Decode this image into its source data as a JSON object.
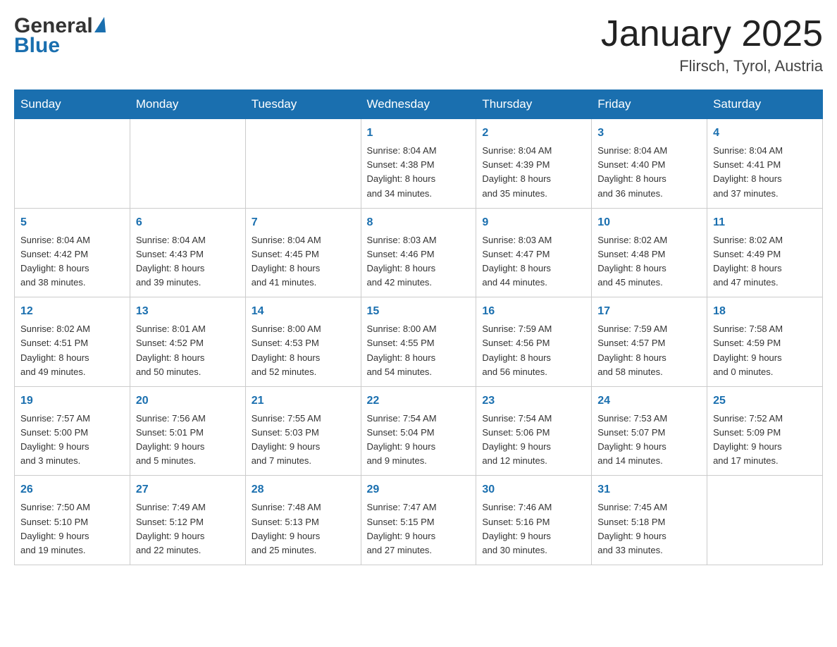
{
  "header": {
    "logo": {
      "text_general": "General",
      "text_blue": "Blue"
    },
    "title": "January 2025",
    "subtitle": "Flirsch, Tyrol, Austria"
  },
  "calendar": {
    "days_of_week": [
      "Sunday",
      "Monday",
      "Tuesday",
      "Wednesday",
      "Thursday",
      "Friday",
      "Saturday"
    ],
    "weeks": [
      [
        {
          "day": "",
          "info": ""
        },
        {
          "day": "",
          "info": ""
        },
        {
          "day": "",
          "info": ""
        },
        {
          "day": "1",
          "info": "Sunrise: 8:04 AM\nSunset: 4:38 PM\nDaylight: 8 hours\nand 34 minutes."
        },
        {
          "day": "2",
          "info": "Sunrise: 8:04 AM\nSunset: 4:39 PM\nDaylight: 8 hours\nand 35 minutes."
        },
        {
          "day": "3",
          "info": "Sunrise: 8:04 AM\nSunset: 4:40 PM\nDaylight: 8 hours\nand 36 minutes."
        },
        {
          "day": "4",
          "info": "Sunrise: 8:04 AM\nSunset: 4:41 PM\nDaylight: 8 hours\nand 37 minutes."
        }
      ],
      [
        {
          "day": "5",
          "info": "Sunrise: 8:04 AM\nSunset: 4:42 PM\nDaylight: 8 hours\nand 38 minutes."
        },
        {
          "day": "6",
          "info": "Sunrise: 8:04 AM\nSunset: 4:43 PM\nDaylight: 8 hours\nand 39 minutes."
        },
        {
          "day": "7",
          "info": "Sunrise: 8:04 AM\nSunset: 4:45 PM\nDaylight: 8 hours\nand 41 minutes."
        },
        {
          "day": "8",
          "info": "Sunrise: 8:03 AM\nSunset: 4:46 PM\nDaylight: 8 hours\nand 42 minutes."
        },
        {
          "day": "9",
          "info": "Sunrise: 8:03 AM\nSunset: 4:47 PM\nDaylight: 8 hours\nand 44 minutes."
        },
        {
          "day": "10",
          "info": "Sunrise: 8:02 AM\nSunset: 4:48 PM\nDaylight: 8 hours\nand 45 minutes."
        },
        {
          "day": "11",
          "info": "Sunrise: 8:02 AM\nSunset: 4:49 PM\nDaylight: 8 hours\nand 47 minutes."
        }
      ],
      [
        {
          "day": "12",
          "info": "Sunrise: 8:02 AM\nSunset: 4:51 PM\nDaylight: 8 hours\nand 49 minutes."
        },
        {
          "day": "13",
          "info": "Sunrise: 8:01 AM\nSunset: 4:52 PM\nDaylight: 8 hours\nand 50 minutes."
        },
        {
          "day": "14",
          "info": "Sunrise: 8:00 AM\nSunset: 4:53 PM\nDaylight: 8 hours\nand 52 minutes."
        },
        {
          "day": "15",
          "info": "Sunrise: 8:00 AM\nSunset: 4:55 PM\nDaylight: 8 hours\nand 54 minutes."
        },
        {
          "day": "16",
          "info": "Sunrise: 7:59 AM\nSunset: 4:56 PM\nDaylight: 8 hours\nand 56 minutes."
        },
        {
          "day": "17",
          "info": "Sunrise: 7:59 AM\nSunset: 4:57 PM\nDaylight: 8 hours\nand 58 minutes."
        },
        {
          "day": "18",
          "info": "Sunrise: 7:58 AM\nSunset: 4:59 PM\nDaylight: 9 hours\nand 0 minutes."
        }
      ],
      [
        {
          "day": "19",
          "info": "Sunrise: 7:57 AM\nSunset: 5:00 PM\nDaylight: 9 hours\nand 3 minutes."
        },
        {
          "day": "20",
          "info": "Sunrise: 7:56 AM\nSunset: 5:01 PM\nDaylight: 9 hours\nand 5 minutes."
        },
        {
          "day": "21",
          "info": "Sunrise: 7:55 AM\nSunset: 5:03 PM\nDaylight: 9 hours\nand 7 minutes."
        },
        {
          "day": "22",
          "info": "Sunrise: 7:54 AM\nSunset: 5:04 PM\nDaylight: 9 hours\nand 9 minutes."
        },
        {
          "day": "23",
          "info": "Sunrise: 7:54 AM\nSunset: 5:06 PM\nDaylight: 9 hours\nand 12 minutes."
        },
        {
          "day": "24",
          "info": "Sunrise: 7:53 AM\nSunset: 5:07 PM\nDaylight: 9 hours\nand 14 minutes."
        },
        {
          "day": "25",
          "info": "Sunrise: 7:52 AM\nSunset: 5:09 PM\nDaylight: 9 hours\nand 17 minutes."
        }
      ],
      [
        {
          "day": "26",
          "info": "Sunrise: 7:50 AM\nSunset: 5:10 PM\nDaylight: 9 hours\nand 19 minutes."
        },
        {
          "day": "27",
          "info": "Sunrise: 7:49 AM\nSunset: 5:12 PM\nDaylight: 9 hours\nand 22 minutes."
        },
        {
          "day": "28",
          "info": "Sunrise: 7:48 AM\nSunset: 5:13 PM\nDaylight: 9 hours\nand 25 minutes."
        },
        {
          "day": "29",
          "info": "Sunrise: 7:47 AM\nSunset: 5:15 PM\nDaylight: 9 hours\nand 27 minutes."
        },
        {
          "day": "30",
          "info": "Sunrise: 7:46 AM\nSunset: 5:16 PM\nDaylight: 9 hours\nand 30 minutes."
        },
        {
          "day": "31",
          "info": "Sunrise: 7:45 AM\nSunset: 5:18 PM\nDaylight: 9 hours\nand 33 minutes."
        },
        {
          "day": "",
          "info": ""
        }
      ]
    ]
  }
}
